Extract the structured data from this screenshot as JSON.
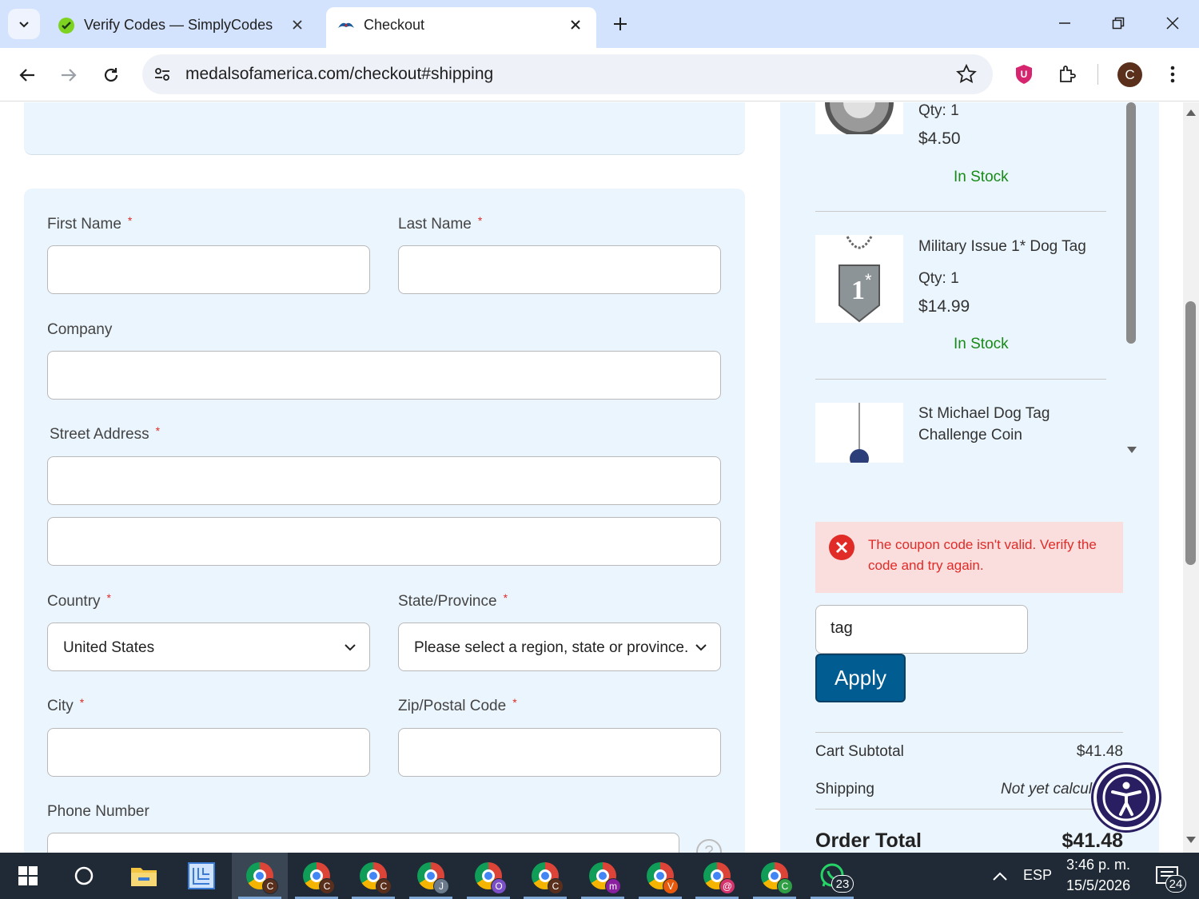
{
  "browser": {
    "tabs": [
      {
        "title": "Verify Codes — SimplyCodes",
        "active": false
      },
      {
        "title": "Checkout",
        "active": true
      }
    ],
    "url": "medalsofamerica.com/checkout#shipping",
    "profile_initial": "C"
  },
  "form": {
    "first_name_label": "First Name",
    "last_name_label": "Last Name",
    "company_label": "Company",
    "street_label": "Street Address",
    "country_label": "Country",
    "country_value": "United States",
    "state_label": "State/Province",
    "state_value": "Please select a region, state or province.",
    "city_label": "City",
    "zip_label": "Zip/Postal Code",
    "phone_label": "Phone Number",
    "required_mark": "*",
    "help_glyph": "?"
  },
  "summary": {
    "items": [
      {
        "name_lines": [],
        "qty": "Qty: 1",
        "price": "$4.50",
        "stock": "In Stock",
        "image": "medal-icon"
      },
      {
        "name_lines": [
          "Military Issue 1* Dog Tag"
        ],
        "qty": "Qty: 1",
        "price": "$14.99",
        "stock": "In Stock",
        "image": "dog-tag-icon"
      },
      {
        "name_lines": [
          "St Michael Dog Tag",
          "Challenge Coin"
        ],
        "qty": "",
        "price": "",
        "stock": "",
        "image": "coin-icon"
      }
    ],
    "error_message": "The coupon code isn't valid. Verify the code and try again.",
    "coupon_value": "tag",
    "apply_label": "Apply",
    "subtotal_label": "Cart Subtotal",
    "subtotal_value": "$41.48",
    "shipping_label": "Shipping",
    "shipping_value": "Not yet calcul",
    "order_total_label": "Order Total",
    "order_total_value": "$41.48"
  },
  "taskbar": {
    "apps": [
      {
        "name": "start-button",
        "badge": ""
      },
      {
        "name": "search-button",
        "badge": ""
      },
      {
        "name": "file-explorer",
        "badge": ""
      },
      {
        "name": "app-4",
        "badge": ""
      },
      {
        "name": "chrome",
        "badge": "C",
        "badge_color": "#5a2f1c"
      },
      {
        "name": "chrome",
        "badge": "C",
        "badge_color": "#5a2f1c"
      },
      {
        "name": "chrome",
        "badge": "C",
        "badge_color": "#5a2f1c"
      },
      {
        "name": "chrome",
        "badge": "J",
        "badge_color": "#6b7b8c"
      },
      {
        "name": "chrome",
        "badge": "O",
        "badge_color": "#7b4fc8"
      },
      {
        "name": "chrome",
        "badge": "C",
        "badge_color": "#5a2f1c"
      },
      {
        "name": "chrome",
        "badge": "m",
        "badge_color": "#8a1fa0"
      },
      {
        "name": "chrome",
        "badge": "V",
        "badge_color": "#e8590c"
      },
      {
        "name": "chrome",
        "badge": "@",
        "badge_color": "#d6336c"
      },
      {
        "name": "chrome",
        "badge": "C",
        "badge_color": "#2f9e44"
      },
      {
        "name": "whatsapp",
        "badge": "23",
        "badge_color": "#1f2a36"
      }
    ],
    "language": "ESP",
    "time": "3:46 p. m.",
    "date": "15/5/2026",
    "notifications": "24"
  }
}
